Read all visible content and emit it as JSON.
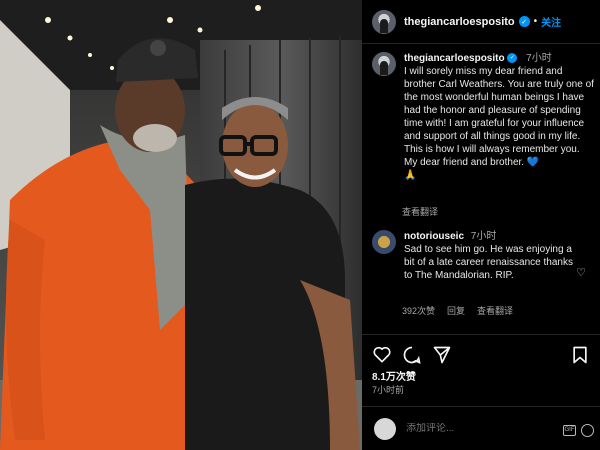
{
  "header": {
    "username": "thegiancarloesposito",
    "separator": "•",
    "follow_label": "关注",
    "verified_icon": "verified-badge-icon"
  },
  "caption": {
    "username": "thegiancarloesposito",
    "time": "7小时",
    "text": "I will sorely miss my dear friend and brother Carl Weathers. You are truly one of the most wonderful human beings I have had the honor and pleasure of spending time with! I am grateful for your influence and support of all things good in my life. This is how I will always remember you. My dear friend and brother.",
    "emoji_heart": "💙",
    "emoji_pray": "🙏",
    "translate_label": "查看翻译"
  },
  "comment": {
    "username": "notoriouseic",
    "time": "7小时",
    "text": "Sad to see him go. He was enjoying a bit of a late career renaissance thanks to The Mandalorian. RIP.",
    "likes": "392次赞",
    "reply_label": "回复",
    "translate_label": "查看翻译"
  },
  "actions": {
    "icons": [
      "heart-icon",
      "comment-icon",
      "share-icon",
      "bookmark-icon"
    ],
    "likes_count": "8.1万次赞",
    "posted_ago": "7小时前"
  },
  "add_comment": {
    "placeholder": "添加评论..."
  },
  "colors": {
    "accent": "#0095f6",
    "background": "#000000",
    "secondary_text": "#a8a8a8"
  }
}
